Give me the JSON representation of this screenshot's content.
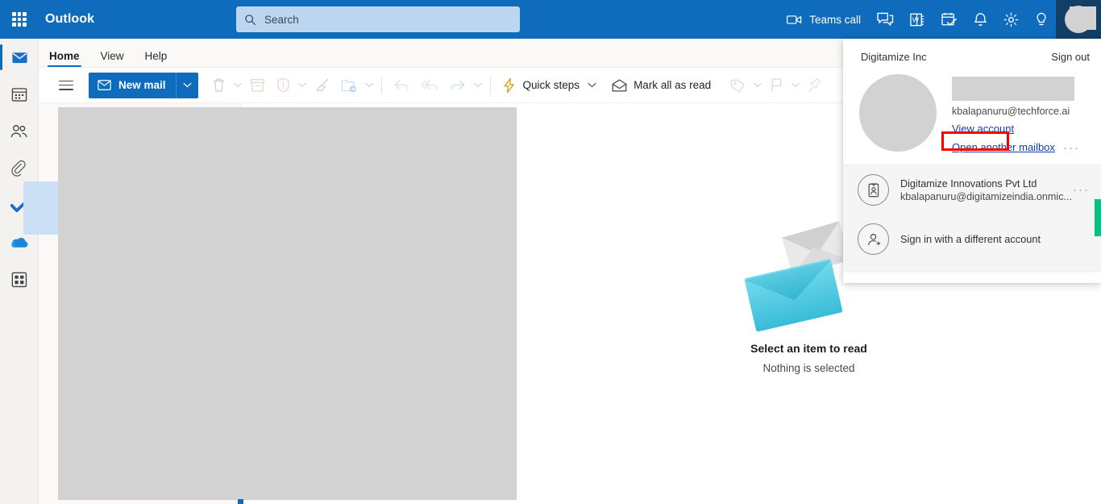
{
  "header": {
    "waffle_icon": "app-launcher-icon",
    "brand": "Outlook",
    "search": {
      "placeholder": "Search",
      "icon": "search-icon",
      "value": ""
    },
    "right_items": [
      {
        "icon": "video-camera-icon",
        "label": "Teams call"
      },
      {
        "icon": "chat-icon",
        "label": ""
      },
      {
        "icon": "contacts-card-icon",
        "label": ""
      },
      {
        "icon": "calendar-check-icon",
        "label": ""
      },
      {
        "icon": "bell-icon",
        "label": ""
      },
      {
        "icon": "gear-icon",
        "label": ""
      },
      {
        "icon": "lightbulb-icon",
        "label": ""
      }
    ],
    "avatar_icon": "user-avatar"
  },
  "rail": {
    "items": [
      {
        "icon": "mail-icon",
        "label": "Mail",
        "active": true
      },
      {
        "icon": "calendar-icon",
        "label": "Calendar",
        "active": false
      },
      {
        "icon": "people-icon",
        "label": "People",
        "active": false
      },
      {
        "icon": "attachment-icon",
        "label": "Files",
        "active": false
      },
      {
        "icon": "todo-check-icon",
        "label": "To Do",
        "active": false
      },
      {
        "icon": "onedrive-cloud-icon",
        "label": "OneDrive",
        "active": false
      },
      {
        "icon": "apps-grid-icon",
        "label": "Apps",
        "active": false
      }
    ]
  },
  "tabs": [
    {
      "label": "Home",
      "active": true
    },
    {
      "label": "View",
      "active": false
    },
    {
      "label": "Help",
      "active": false
    }
  ],
  "ribbon": {
    "hamburger_icon": "hamburger-menu-icon",
    "new_mail": {
      "label": "New mail",
      "icon": "envelope-icon",
      "caret_icon": "chevron-down-icon"
    },
    "delete": {
      "icon": "trash-icon",
      "caret_icon": "chevron-down-icon"
    },
    "archive": {
      "icon": "archive-box-icon"
    },
    "report": {
      "icon": "shield-alert-icon",
      "caret_icon": "chevron-down-icon"
    },
    "sweep": {
      "icon": "broom-icon"
    },
    "move_to": {
      "icon": "move-folder-icon",
      "caret_icon": "chevron-down-icon"
    },
    "undo": {
      "icon": "reply-arrow-icon"
    },
    "reply_all": {
      "icon": "reply-all-arrow-icon"
    },
    "forward": {
      "icon": "forward-arrow-icon",
      "caret_icon": "chevron-down-icon"
    },
    "quick_steps": {
      "label": "Quick steps",
      "icon": "lightning-bolt-icon",
      "caret_icon": "chevron-down-icon"
    },
    "mark_all_read": {
      "label": "Mark all as read",
      "icon": "open-envelope-icon"
    },
    "categorize": {
      "icon": "tag-icon",
      "caret_icon": "chevron-down-icon"
    },
    "flag": {
      "icon": "flag-icon",
      "caret_icon": "chevron-down-icon"
    },
    "pin": {
      "icon": "pin-icon"
    }
  },
  "reading_pane": {
    "illustration_icon": "empty-mailbox-envelopes",
    "title": "Select an item to read",
    "subtitle": "Nothing is selected"
  },
  "account_flyout": {
    "org": "Digitamize Inc",
    "sign_out": "Sign out",
    "avatar_icon": "user-avatar-large",
    "name_redacted": "",
    "email": "kbalapanuru@techforce.ai",
    "view_account": "View account",
    "open_another_mailbox": "Open another mailbox",
    "overflow_icon": "more-options-icon",
    "overflow_dots": "···",
    "accounts": [
      {
        "icon": "badge-id-icon",
        "name": "Digitamize Innovations Pvt Ltd",
        "email": "kbalapanuru@digitamizeindia.onmic...",
        "overflow_dots": "···"
      }
    ],
    "sign_in_other": {
      "icon": "add-person-icon",
      "label": "Sign in with a different account"
    },
    "highlight_color": "#f40000"
  }
}
